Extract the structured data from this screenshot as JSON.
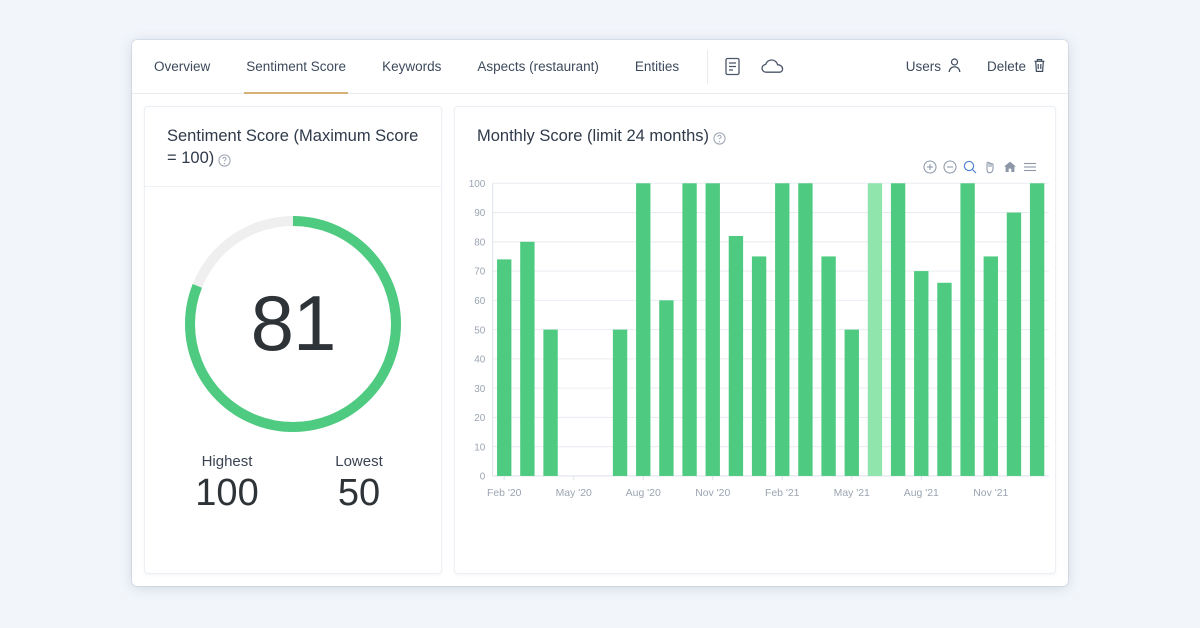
{
  "nav": {
    "tabs": [
      {
        "label": "Overview",
        "active": false
      },
      {
        "label": "Sentiment Score",
        "active": true
      },
      {
        "label": "Keywords",
        "active": false
      },
      {
        "label": "Aspects (restaurant)",
        "active": false
      },
      {
        "label": "Entities",
        "active": false
      }
    ],
    "icons": [
      "document-icon",
      "cloud-icon"
    ],
    "users_label": "Users",
    "delete_label": "Delete"
  },
  "sentiment_card": {
    "title": "Sentiment Score (Maximum Score = 100)",
    "score": "81",
    "score_percent": 81,
    "highest_label": "Highest",
    "highest_value": "100",
    "lowest_label": "Lowest",
    "lowest_value": "50"
  },
  "monthly_card": {
    "title": "Monthly Score (limit 24 months)",
    "toolbar": [
      "zoom-in-icon",
      "zoom-out-icon",
      "selection-zoom-icon",
      "panning-icon",
      "reset-zoom-icon",
      "menu-icon"
    ]
  },
  "colors": {
    "bar": "#4ecb81",
    "bar_highlight": "#8fe5ac",
    "gauge_track": "#efefef",
    "accent_tab": "#d8b177",
    "page_bg": "#f2f6fb"
  },
  "chart_data": {
    "type": "bar",
    "title": "Monthly Score (limit 24 months)",
    "xlabel": "",
    "ylabel": "",
    "ylim": [
      0,
      100
    ],
    "yticks": [
      0,
      10,
      20,
      30,
      40,
      50,
      60,
      70,
      80,
      90,
      100
    ],
    "grid": true,
    "legend": false,
    "xtick_labels": [
      "Feb '20",
      "May '20",
      "Aug '20",
      "Nov '20",
      "Feb '21",
      "May '21",
      "Aug '21",
      "Nov '21"
    ],
    "categories": [
      "Feb '20",
      "Mar '20",
      "Apr '20",
      "May '20",
      "Jun '20",
      "Jul '20",
      "Aug '20",
      "Sep '20",
      "Oct '20",
      "Nov '20",
      "Dec '20",
      "Jan '21",
      "Feb '21",
      "Mar '21",
      "Apr '21",
      "May '21",
      "Jun '21",
      "Jul '21",
      "Aug '21",
      "Sep '21",
      "Oct '21",
      "Nov '21",
      "Dec '21",
      "Jan '22"
    ],
    "values": [
      74,
      80,
      50,
      null,
      null,
      50,
      100,
      60,
      100,
      100,
      82,
      75,
      100,
      100,
      75,
      50,
      100,
      100,
      70,
      66,
      100,
      75,
      90,
      100
    ],
    "highlighted_index": 16,
    "highlighted_label": "Jun '21"
  }
}
